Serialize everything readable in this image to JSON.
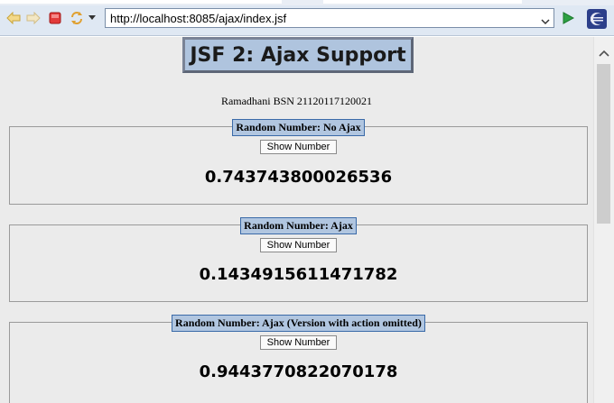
{
  "browser": {
    "url": "http://localhost:8085/ajax/index.jsf",
    "icons": [
      "back-icon",
      "forward-icon",
      "stop-icon",
      "refresh-icon",
      "menu-dropdown-icon",
      "url-dropdown-icon",
      "go-icon",
      "eclipse-icon"
    ]
  },
  "page": {
    "title": "JSF 2: Ajax Support",
    "subtitle": "Ramadhani BSN 21120117120021",
    "panels": [
      {
        "legend": "Random Number: No Ajax",
        "button": "Show Number",
        "value": "0.743743800026536"
      },
      {
        "legend": "Random Number: Ajax",
        "button": "Show Number",
        "value": "0.1434915611471782"
      },
      {
        "legend": "Random Number: Ajax (Version with action omitted)",
        "button": "Show Number",
        "value": "0.9443770822070178"
      }
    ]
  },
  "colors": {
    "title_bg": "#afc4de",
    "legend_bg": "#b1c6e0",
    "legend_border": "#3a6aa8",
    "page_bg": "#ebebeb",
    "toolbar_bg": "#dfe8f3"
  }
}
